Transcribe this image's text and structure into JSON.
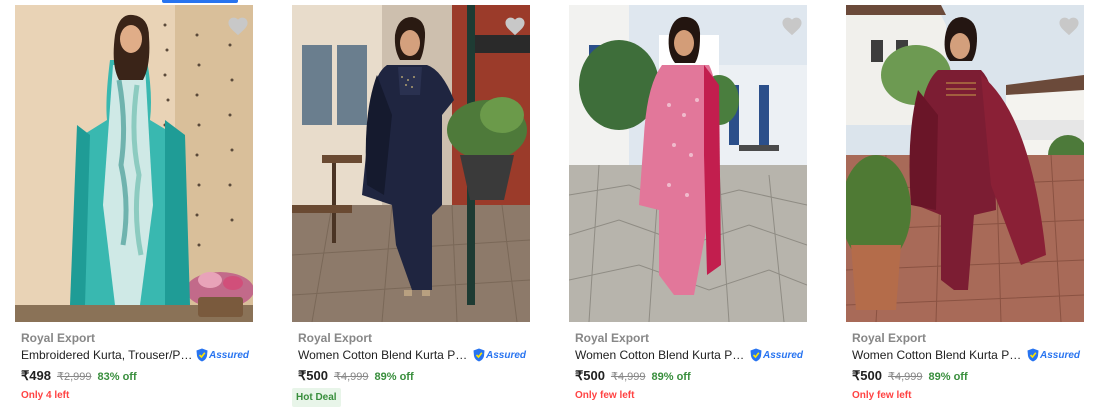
{
  "products": [
    {
      "brand": "Royal Export",
      "title": "Embroidered Kurta, Trouser/Pant...",
      "assured_label": "Assured",
      "price": "₹498",
      "mrp": "₹2,999",
      "discount": "83% off",
      "tag": "Only 4 left",
      "image_icon": "woman-teal-kurta-photo"
    },
    {
      "brand": "Royal Export",
      "title": "Women Cotton Blend Kurta Pant ...",
      "assured_label": "Assured",
      "price": "₹500",
      "mrp": "₹4,999",
      "discount": "89% off",
      "deal": "Hot Deal",
      "image_icon": "woman-navy-kurta-photo"
    },
    {
      "brand": "Royal Export",
      "title": "Women Cotton Blend Kurta Pant ...",
      "assured_label": "Assured",
      "price": "₹500",
      "mrp": "₹4,999",
      "discount": "89% off",
      "tag": "Only few left",
      "image_icon": "woman-pink-kurta-photo"
    },
    {
      "brand": "Royal Export",
      "title": "Women Cotton Blend Kurta Pant ...",
      "assured_label": "Assured",
      "price": "₹500",
      "mrp": "₹4,999",
      "discount": "89% off",
      "tag": "Only few left",
      "image_icon": "woman-maroon-kurta-photo"
    }
  ],
  "colors": {
    "accent": "#2874f0",
    "discount": "#388e3c",
    "stock_warning": "#ff4343",
    "brand_text": "#878787"
  }
}
